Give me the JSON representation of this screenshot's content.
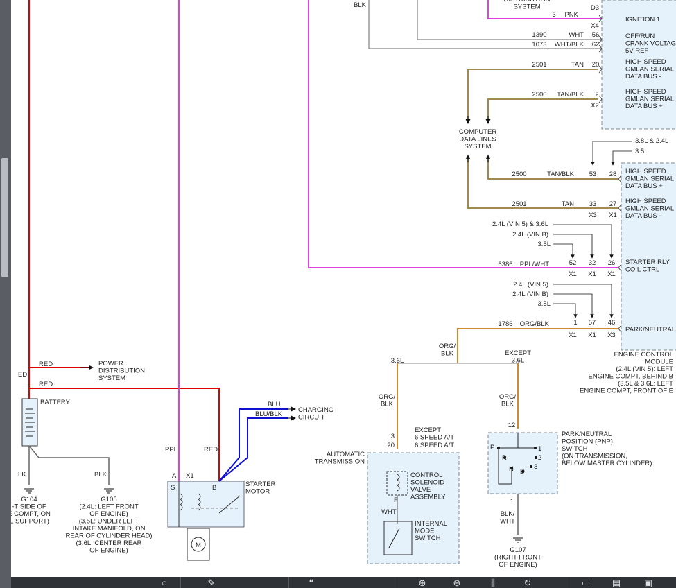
{
  "labels": {
    "top_blk": "BLK",
    "distribution_system": "DISTRIBUTION\nSYSTEM",
    "pnk_circuit": "3",
    "pnk": "PNK",
    "d3": "D3",
    "x4": "X4",
    "ignition1": "IGNITION 1",
    "c1390": "1390",
    "wht": "WHT",
    "p56": "56",
    "c1073": "1073",
    "wht_blk": "WHT/BLK",
    "p62": "62",
    "off_run": "OFF/RUN\nCRANK VOLTAGE\n5V REF",
    "c2501a": "2501",
    "tan_a": "TAN",
    "p20": "20",
    "hs_bus_minus_a": "HIGH SPEED\nGMLAN SERIAL\nDATA BUS -",
    "c2500a": "2500",
    "tanblk_a": "TAN/BLK",
    "p2": "2",
    "x2": "X2",
    "hs_bus_plus_a": "HIGH SPEED\nGMLAN SERIAL\nDATA BUS +",
    "computer_data_lines": "COMPUTER\nDATA LINES\nSYSTEM",
    "opt_38_24": "3.8L & 2.4L",
    "opt_35_a": "3.5L",
    "c2500b": "2500",
    "tanblk_b": "TAN/BLK",
    "p53": "53",
    "p28": "28",
    "hs_bus_plus_b": "HIGH SPEED\nGMLAN SERIAL\nDATA BUS +",
    "c2501b": "2501",
    "tan_b": "TAN",
    "p33": "33",
    "p27": "27",
    "x3_a": "X3",
    "x1_a": "X1",
    "hs_bus_minus_b": "HIGH SPEED\nGMLAN SERIAL\nDATA BUS -",
    "opt_24vin5_36": "2.4L (VIN 5) & 3.6L",
    "opt_24vinb_a": "2.4L (VIN B)",
    "opt_35_b": "3.5L",
    "c6386": "6386",
    "ppl_wht": "PPL/WHT",
    "p52": "52",
    "p32": "32",
    "p26": "26",
    "x1_b": "X1",
    "x1_c": "X1",
    "x1_d": "X1",
    "starter_rly": "STARTER RLY\nCOIL CTRL",
    "opt_24vin5_b": "2.4L (VIN 5)",
    "opt_24vinb_b": "2.4L (VIN B)",
    "opt_35_c": "3.5L",
    "c1786": "1786",
    "org_blk_a": "ORG/BLK",
    "p1": "1",
    "p57": "57",
    "p46": "46",
    "x1_e": "X1",
    "x1_f": "X1",
    "x3_b": "X3",
    "park_neutral": "PARK/NEUTRAL",
    "ecm": "ENGINE CONTROL\nMODULE\n(2.4L (VIN 5): LEFT\nENGINE COMPT, BEHIND B\n(3.5L & 3.6L: LEFT\nENGINE COMPT, FRONT OF E",
    "org_blk_b": "ORG/\nBLK",
    "opt_36": "3.6L",
    "except_36": "EXCEPT\n3.6L",
    "org_blk_c": "ORG/\nBLK",
    "org_blk_d": "ORG/\nBLK",
    "red_a": "RED",
    "power_dist": "POWER\nDISTRIBUTION\nSYSTEM",
    "red_b": "RED",
    "ed": "ED",
    "battery": "BATTERY",
    "blu": "BLU",
    "blu_blk": "BLU/BLK",
    "charging": "CHARGING\nCIRCUIT",
    "ppl": "PPL",
    "red_c": "RED",
    "a": "A",
    "x1_starter": "X1",
    "b": "B",
    "s": "S",
    "starter_motor": "STARTER\nMOTOR",
    "m": "M",
    "blk_a": "LK",
    "blk_b": "BLK",
    "g104": "G104\n-T SIDE OF\nE COMPT, ON\nE SUPPORT)",
    "g105": "G105\n(2.4L: LEFT FRONT\nOF ENGINE)\n(3.5L: UNDER LEFT\nINTAKE MANIFOLD, ON\nREAR OF CYLINDER HEAD)\n(3.6L: CENTER REAR\nOF ENGINE)",
    "p3": "3",
    "p20b": "20",
    "except6": "EXCEPT\n6 SPEED A/T",
    "six_speed": "6 SPEED A/T",
    "auto_trans": "AUTOMATIC\nTRANSMISSION",
    "ctrl_sol": "CONTROL\nSOLENOID\nVALVE\nASSEMBLY",
    "f": "F",
    "wht_b": "WHT",
    "internal_mode": "INTERNAL\nMODE\nSWITCH",
    "p12": "12",
    "pnp": "PARK/NEUTRAL\nPOSITION (PNP)\nSWITCH\n(ON TRANSMISSION,\nBELOW MASTER CYLINDER)",
    "sw_p": "P",
    "sw_r": "R",
    "sw_n": "N",
    "sw_d": "D",
    "sw_1": "1",
    "sw_2": "2",
    "sw_3": "3",
    "p1b": "1",
    "blk_wht": "BLK/\nWHT",
    "g107": "G107\n(RIGHT FRONT\nOF ENGINE)"
  },
  "colors": {
    "red": "#e00000",
    "pink": "#e040e0",
    "blue": "#1010d0",
    "tan": "#a08a50",
    "orange": "#d08a30",
    "gray": "#888888",
    "black": "#111111",
    "module_fill": "#e6f2fb",
    "module_border": "#7b8a96"
  },
  "toolbar": {
    "icons": [
      "zoom-icon",
      "pen-icon",
      "quote-icon",
      "zoom-in-icon",
      "zoom-out-icon",
      "grid-icon",
      "rotate-icon",
      "doc-icon",
      "print-icon",
      "save-icon"
    ]
  }
}
